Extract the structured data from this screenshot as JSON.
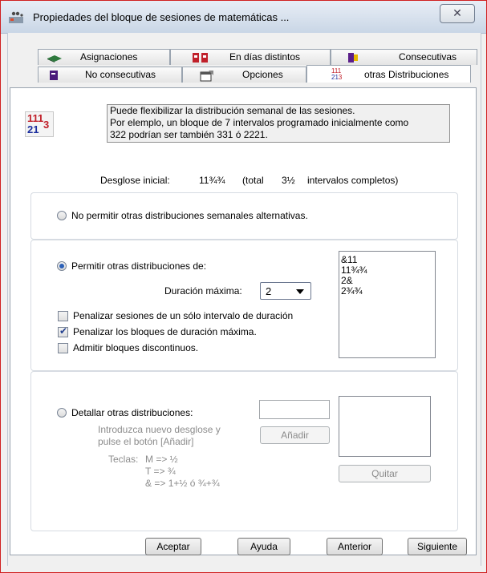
{
  "window": {
    "title": "Propiedades del bloque de sesiones de matemáticas ...",
    "close_glyph": "✕"
  },
  "tabs_back": [
    {
      "label": "Asignaciones",
      "icon": "book-icon"
    },
    {
      "label": "En días distintos",
      "icon": "calendar-split-icon"
    },
    {
      "label": "Consecutivas",
      "icon": "consecutive-icon"
    }
  ],
  "tabs_front": [
    {
      "label": "No consecutivas",
      "icon": "non-consecutive-icon"
    },
    {
      "label": "Opciones",
      "icon": "options-icon"
    },
    {
      "label": "otras Distribuciones",
      "icon": "distribution-icon",
      "icon_text": "111 21 3",
      "active": true
    }
  ],
  "info": {
    "icon_text_top": "111",
    "icon_text_side": "3",
    "icon_text_bottom": "21",
    "line1": "Puede flexibilizar la distribución semanal de las sesiones.",
    "line2": "Por elemplo, un bloque de 7 intervalos programado inicialmente como",
    "line3": "322 podrían ser también 331 ó 2221."
  },
  "desglose": {
    "label": "Desglose inicial:",
    "value": "11¾¾",
    "total_label": "(total",
    "total_value": "3½",
    "total_suffix": "intervalos completos)"
  },
  "option_no": {
    "label": "No permitir otras distribuciones semanales alternativas.",
    "checked": false
  },
  "option_permit": {
    "label": "Permitir otras distribuciones de:",
    "checked": true,
    "max_label": "Duración máxima:",
    "max_value": "2",
    "checks": [
      {
        "label": "Penalizar sesiones de un sólo intervalo de duración",
        "checked": false
      },
      {
        "label": "Penalizar los bloques de duración máxima.",
        "checked": true
      },
      {
        "label": "Admitir bloques discontinuos.",
        "checked": false
      }
    ],
    "list": [
      "&11",
      "11¾¾",
      "2&",
      "2¾¾"
    ]
  },
  "option_detail": {
    "label": "Detallar otras distribuciones:",
    "checked": false,
    "hint1": "Introduzca nuevo desglose y",
    "hint2": "pulse el botón [Añadir]",
    "teclas_label": "Teclas:",
    "key1": "M => ½",
    "key2": "T => ¾",
    "key3": "& => 1+½ ó ¾+¾",
    "add_button": "Añadir",
    "remove_button": "Quitar",
    "input_value": ""
  },
  "footer": {
    "ok": "Aceptar",
    "help": "Ayuda",
    "prev": "Anterior",
    "next": "Siguiente"
  },
  "colors": {
    "accent_red": "#c0202a",
    "accent_blue": "#1d2f9e",
    "radio_dot": "#2c61b8"
  }
}
